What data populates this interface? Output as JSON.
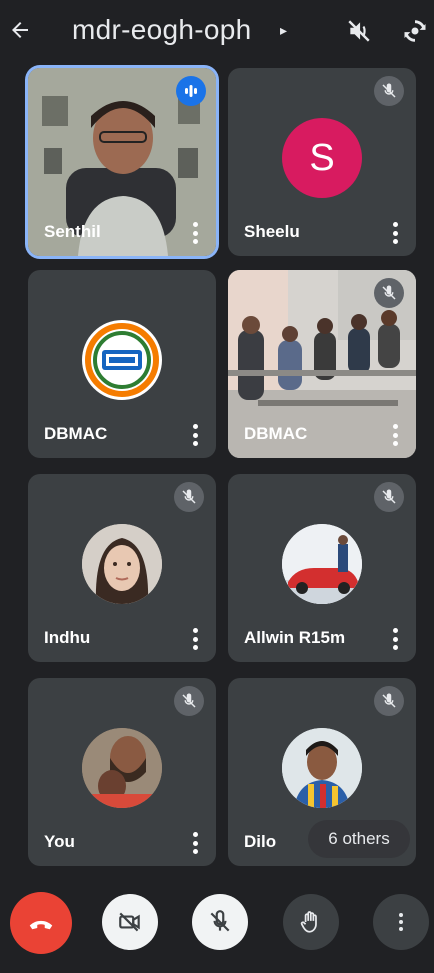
{
  "header": {
    "meeting_code": "mdr-eogh-oph",
    "back_icon": "arrow-left-icon",
    "title_arrow": "▸",
    "audio_icon": "volume-off-icon",
    "camera_switch_icon": "camera-switch-icon"
  },
  "participants": [
    {
      "name": "Senthil",
      "speaking": true
    },
    {
      "name": "Sheelu",
      "avatar_letter": "S",
      "avatar_color": "#d81b60",
      "muted": true
    },
    {
      "name": "DBMAC",
      "avatar": "logo-image"
    },
    {
      "name": "DBMAC",
      "video": "classroom-video",
      "muted": true
    },
    {
      "name": "Indhu",
      "avatar": "profile-photo",
      "muted": true
    },
    {
      "name": "Allwin R15m",
      "avatar": "profile-photo",
      "muted": true
    },
    {
      "name": "You",
      "avatar": "profile-photo",
      "muted": true
    },
    {
      "name": "Dilo",
      "avatar": "profile-photo",
      "muted": true
    }
  ],
  "others_label": "6 others",
  "controls": {
    "end_call_color": "#ea4335",
    "end_call_icon": "phone-hangup-icon",
    "camera_icon": "camera-off-icon",
    "mic_icon": "mic-off-icon",
    "hand_icon": "raise-hand-icon",
    "more_icon": "more-vertical-icon"
  },
  "colors": {
    "background": "#202124",
    "tile": "#3c4043",
    "active_border": "#8ab4f8"
  }
}
